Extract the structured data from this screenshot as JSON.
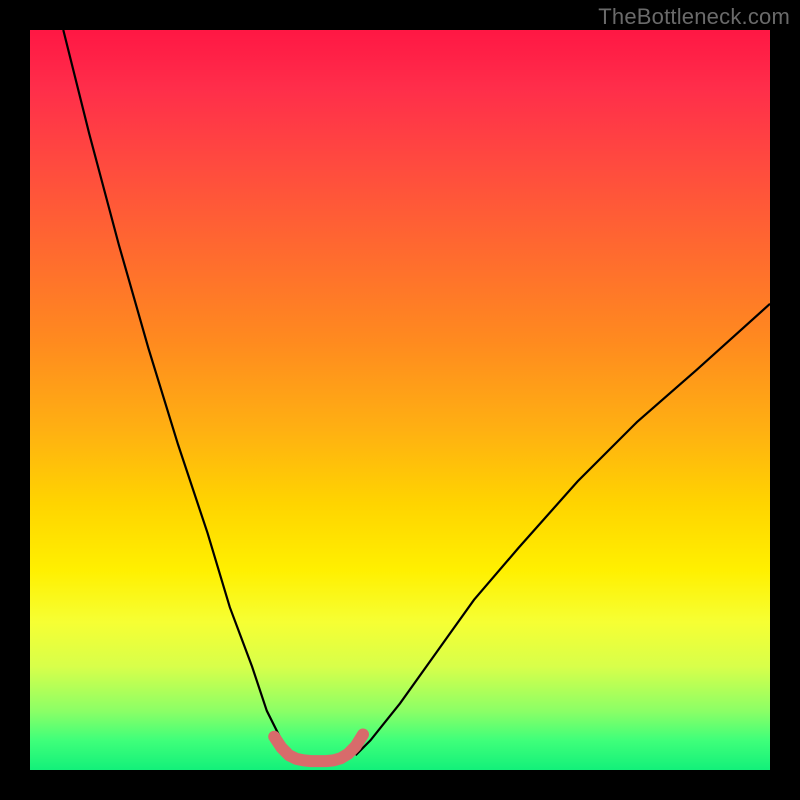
{
  "watermark": "TheBottleneck.com",
  "chart_data": {
    "type": "line",
    "title": "",
    "xlabel": "",
    "ylabel": "",
    "xlim": [
      0,
      100
    ],
    "ylim": [
      0,
      100
    ],
    "grid": false,
    "legend": false,
    "series": [
      {
        "name": "left-descending-curve",
        "color": "#000000",
        "x": [
          4.5,
          8,
          12,
          16,
          20,
          24,
          27,
          30,
          32,
          34,
          35.5
        ],
        "y": [
          100,
          86,
          71,
          57,
          44,
          32,
          22,
          14,
          8,
          4,
          2
        ]
      },
      {
        "name": "right-ascending-curve",
        "color": "#000000",
        "x": [
          44,
          46,
          50,
          55,
          60,
          66,
          74,
          82,
          90,
          100
        ],
        "y": [
          2,
          4,
          9,
          16,
          23,
          30,
          39,
          47,
          54,
          63
        ]
      },
      {
        "name": "bottom-bridge-marker",
        "color": "#d86b6b",
        "x": [
          33,
          34,
          35,
          36,
          37,
          38,
          39,
          40,
          41,
          42,
          43,
          44,
          45
        ],
        "y": [
          4.5,
          3.0,
          2.0,
          1.5,
          1.3,
          1.2,
          1.2,
          1.2,
          1.3,
          1.6,
          2.2,
          3.2,
          4.8
        ]
      }
    ],
    "background_gradient": {
      "type": "vertical",
      "stops": [
        {
          "pos": 0.0,
          "color": "#ff1744"
        },
        {
          "pos": 0.3,
          "color": "#ff6a2f"
        },
        {
          "pos": 0.64,
          "color": "#ffd400"
        },
        {
          "pos": 0.8,
          "color": "#f6ff33"
        },
        {
          "pos": 0.96,
          "color": "#3fff7a"
        },
        {
          "pos": 1.0,
          "color": "#13f07a"
        }
      ]
    }
  }
}
